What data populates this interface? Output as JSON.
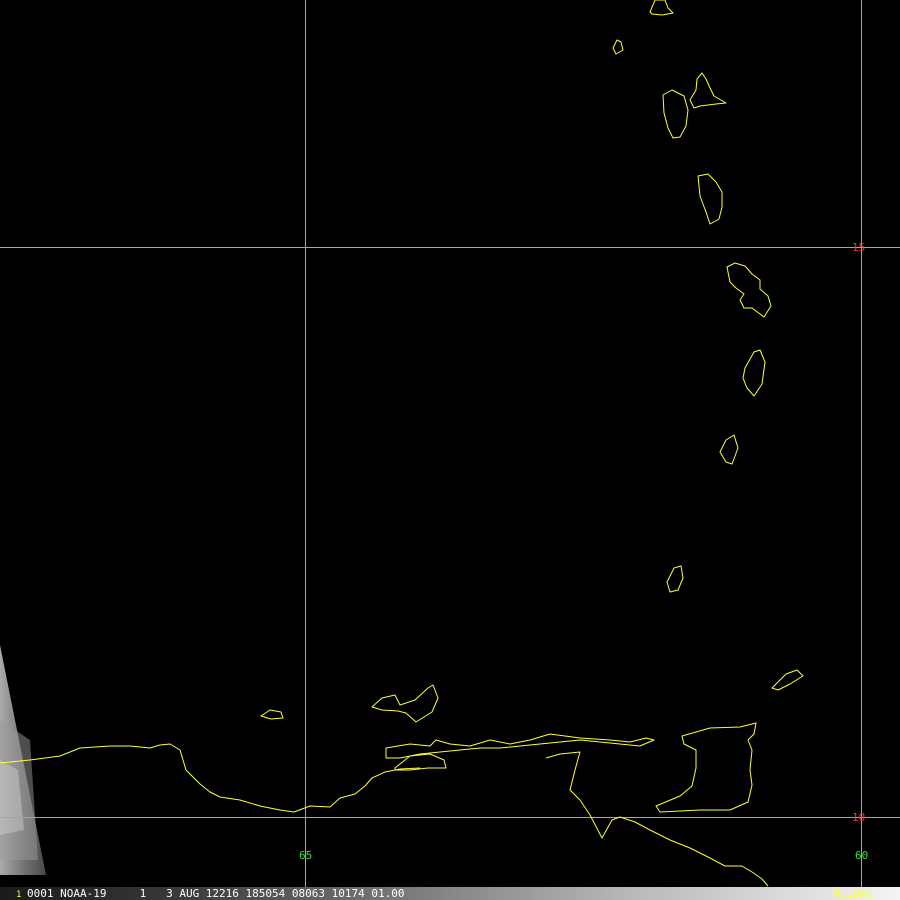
{
  "map": {
    "colors": {
      "background": "#000000",
      "grid": "#3fd0d0",
      "coastline": "#ffff33",
      "lat_label": "#ff3030",
      "lon_label": "#33dd33",
      "status_text": "#ffffff",
      "mcidas": "#ffff33"
    },
    "graticule": {
      "lat_labels": [
        "15",
        "10"
      ],
      "lon_labels": [
        "65",
        "60"
      ]
    }
  },
  "status_bar": {
    "frame": "1",
    "text": "0001 NOAA-19     1   3 AUG 12216 185054 08063 10174 01.00",
    "brand": "McIDAS"
  }
}
